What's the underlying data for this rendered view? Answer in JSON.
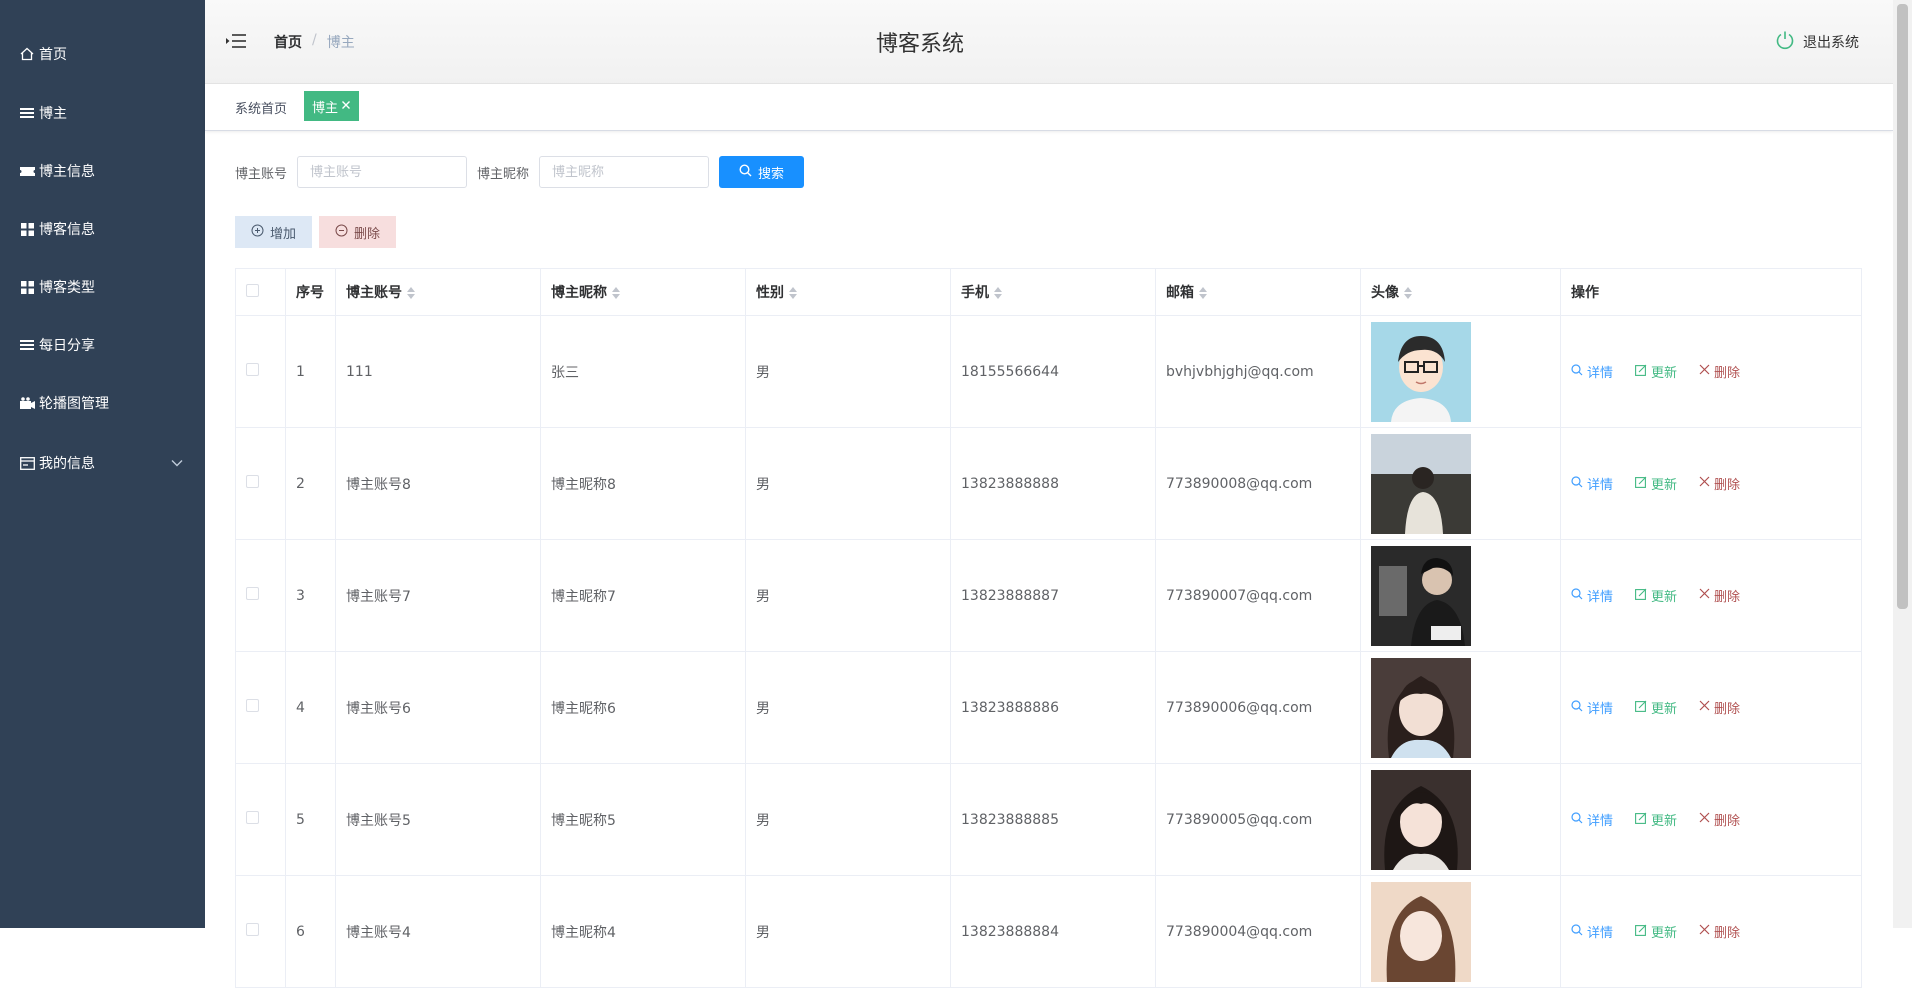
{
  "sidebar": {
    "items": [
      {
        "label": "首页",
        "icon": "home-icon"
      },
      {
        "label": "博主",
        "icon": "list-icon"
      },
      {
        "label": "博主信息",
        "icon": "ticket-icon"
      },
      {
        "label": "博客信息",
        "icon": "grid-icon"
      },
      {
        "label": "博客类型",
        "icon": "grid-icon"
      },
      {
        "label": "每日分享",
        "icon": "list-icon"
      },
      {
        "label": "轮播图管理",
        "icon": "camera-icon"
      },
      {
        "label": "我的信息",
        "icon": "card-icon"
      }
    ]
  },
  "header": {
    "breadcrumb": {
      "home": "首页",
      "current": "博主"
    },
    "title": "博客系统",
    "logout": "退出系统"
  },
  "tags": {
    "home": "系统首页",
    "active": "博主"
  },
  "search": {
    "account_label": "博主账号",
    "account_placeholder": "博主账号",
    "nickname_label": "博主昵称",
    "nickname_placeholder": "博主昵称",
    "button": "搜索"
  },
  "actions": {
    "add": "增加",
    "delete": "删除"
  },
  "table": {
    "headers": [
      "序号",
      "博主账号",
      "博主昵称",
      "性别",
      "手机",
      "邮箱",
      "头像",
      "操作"
    ],
    "rows": [
      {
        "index": "1",
        "account": "111",
        "nickname": "张三",
        "gender": "男",
        "phone": "18155566644",
        "email": "bvhjvbhjghj@qq.com"
      },
      {
        "index": "2",
        "account": "博主账号8",
        "nickname": "博主昵称8",
        "gender": "男",
        "phone": "13823888888",
        "email": "773890008@qq.com"
      },
      {
        "index": "3",
        "account": "博主账号7",
        "nickname": "博主昵称7",
        "gender": "男",
        "phone": "13823888887",
        "email": "773890007@qq.com"
      },
      {
        "index": "4",
        "account": "博主账号6",
        "nickname": "博主昵称6",
        "gender": "男",
        "phone": "13823888886",
        "email": "773890006@qq.com"
      },
      {
        "index": "5",
        "account": "博主账号5",
        "nickname": "博主昵称5",
        "gender": "男",
        "phone": "13823888885",
        "email": "773890005@qq.com"
      },
      {
        "index": "6",
        "account": "博主账号4",
        "nickname": "博主昵称4",
        "gender": "男",
        "phone": "13823888884",
        "email": "773890004@qq.com"
      }
    ],
    "ops": {
      "detail": "详情",
      "update": "更新",
      "delete": "删除"
    }
  },
  "colors": {
    "sidebar_bg": "#304156",
    "primary": "#1890ff",
    "tag_active": "#42b983",
    "detail": "#409eff",
    "update": "#42b983",
    "delete": "#b05050"
  }
}
